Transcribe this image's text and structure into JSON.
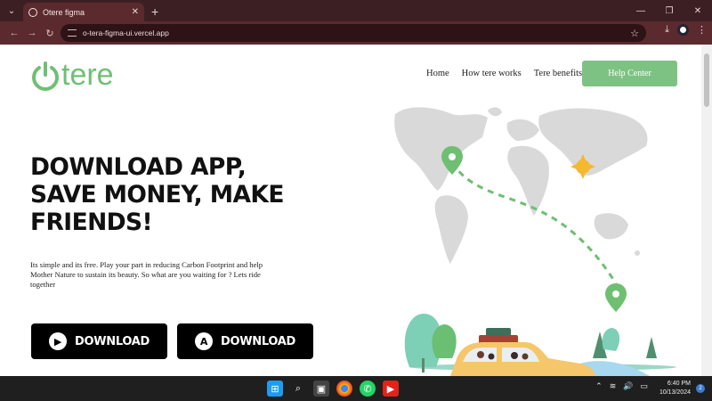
{
  "browser": {
    "tab_title": "Otere figma",
    "url": "o-tera-figma-ui.vercel.app",
    "tab_close": "✕",
    "new_tab": "+"
  },
  "brand": {
    "logo_text": "tere",
    "accent": "#6fbf73"
  },
  "nav": {
    "items": [
      "Home",
      "How tere works",
      "Tere benefits"
    ],
    "help_label": "Help Center"
  },
  "hero": {
    "headline_lines": [
      "DOWNLOAD APP,",
      "SAVE MONEY, MAKE",
      "FRIENDS!"
    ],
    "description": "Its simple and its free. Play your part in reducing Carbon Footprint and help Mother Nature to sustain its beauty. So what are you waiting for ? Lets ride together",
    "buttons": [
      {
        "label": "DOWNLOAD",
        "icon": "google-play-icon"
      },
      {
        "label": "DOWNLOAD",
        "icon": "app-store-icon"
      }
    ]
  },
  "taskbar": {
    "time": "6:40 PM",
    "date": "10/13/2024",
    "notification_count": "2"
  }
}
